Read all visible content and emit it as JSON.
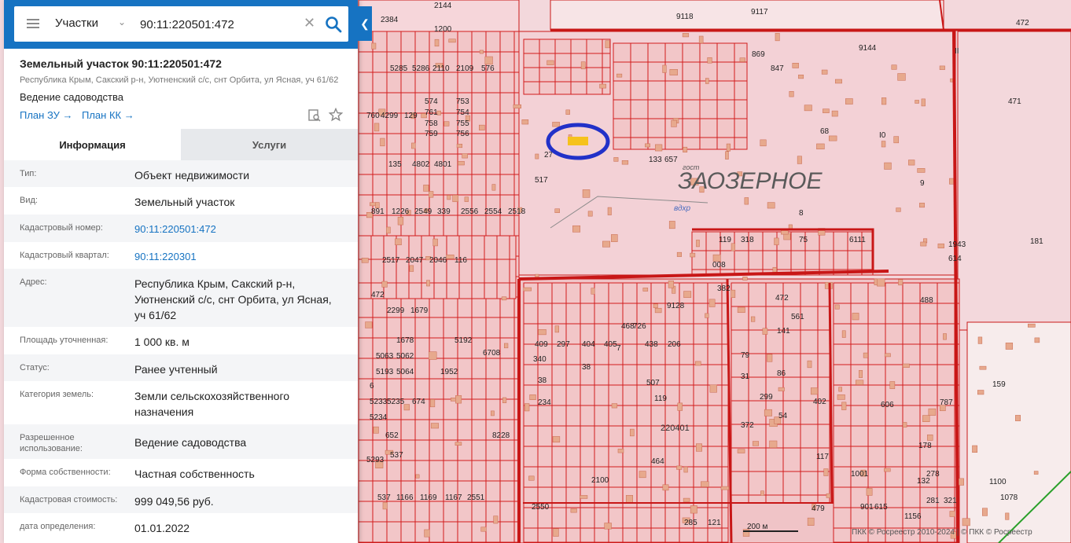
{
  "search": {
    "layer": "Участки",
    "query": "90:11:220501:472"
  },
  "parcel": {
    "title": "Земельный участок 90:11:220501:472",
    "address_short": "Республика Крым, Сакский р-н, Уютненский с/с, снт Орбита, ул Ясная, уч 61/62",
    "usage": "Ведение садоводства",
    "link_zu": "План ЗУ →",
    "link_kk": "План КК →"
  },
  "tabs": {
    "info": "Информация",
    "services": "Услуги"
  },
  "fields": [
    {
      "label": "Тип:",
      "value": "Объект недвижимости"
    },
    {
      "label": "Вид:",
      "value": "Земельный участок"
    },
    {
      "label": "Кадастровый номер:",
      "value": "90:11:220501:472"
    },
    {
      "label": "Кадастровый квартал:",
      "value": "90:11:220301"
    },
    {
      "label": "Адрес:",
      "value": "Республика Крым, Сакский р-н, Уютненский с/с, снт Орбита, ул Ясная, уч 61/62"
    },
    {
      "label": "Площадь уточненная:",
      "value": "1 000 кв. м"
    },
    {
      "label": "Статус:",
      "value": "Ранее учтенный"
    },
    {
      "label": "Категория земель:",
      "value": "Земли сельскохозяйственного назначения"
    },
    {
      "label": "Разрешенное использование:",
      "value": "Ведение садоводства"
    },
    {
      "label": "Форма собственности:",
      "value": "Частная собственность"
    },
    {
      "label": "Кадастровая стоимость:",
      "value": "999 049,56 руб."
    },
    {
      "label": "дата определения:",
      "value": "01.01.2022"
    }
  ],
  "map": {
    "settlement": "ЗАОЗЕРНОЕ",
    "quarter": "220401",
    "water": "вдхр",
    "road": "гост",
    "copyright": "ПКК © Росреестр 2010-2024 | © ПКК © Росреестр",
    "scale": "200 м",
    "labels": [
      "2384",
      "2144",
      "1200",
      "9118",
      "9117",
      "472",
      "9144",
      "II",
      "471",
      "869",
      "847",
      "68",
      "I0",
      "9",
      "8",
      "181",
      "5285",
      "5286",
      "2110",
      "2109",
      "576",
      "574",
      "753",
      "761",
      "754",
      "758",
      "755",
      "759",
      "756",
      "760",
      "4299",
      "129",
      "135",
      "4802",
      "4801",
      "27",
      "517",
      "133",
      "657",
      "891",
      "1226",
      "2549",
      "339",
      "2556",
      "2554",
      "2518",
      "2517",
      "2047",
      "2046",
      "116",
      "119",
      "318",
      "75",
      "6111",
      "1943",
      "614",
      "008",
      "382",
      "472",
      "2299",
      "1679",
      "1678",
      "5062",
      "5064",
      "5063",
      "5193",
      "5192",
      "6708",
      "1952",
      "9128",
      "726",
      "468",
      "472",
      "561",
      "141",
      "79",
      "86",
      "31",
      "299",
      "54",
      "402",
      "372",
      "117",
      "488",
      "606",
      "787",
      "178",
      "132",
      "159",
      "38",
      "234",
      "340",
      "409",
      "297",
      "404",
      "405",
      "438",
      "206",
      "507",
      "119",
      "464",
      "6",
      "5233",
      "5234",
      "5235",
      "674",
      "652",
      "537",
      "8228",
      "5293",
      "537",
      "1166",
      "1169",
      "1167",
      "2551",
      "2550",
      "285",
      "121",
      "479",
      "901",
      "615",
      "1001",
      "278",
      "321",
      "281",
      "1156",
      "1100",
      "1078",
      "2100",
      "38",
      "7",
      "81",
      "23",
      "3"
    ],
    "selected_parcel_color": "#f6c21c",
    "highlight_ring_color": "#2231c8",
    "boundary_color": "#d21c1c",
    "parcel_fill": "#f2c6c8",
    "building_fill": "#e7a98d"
  }
}
